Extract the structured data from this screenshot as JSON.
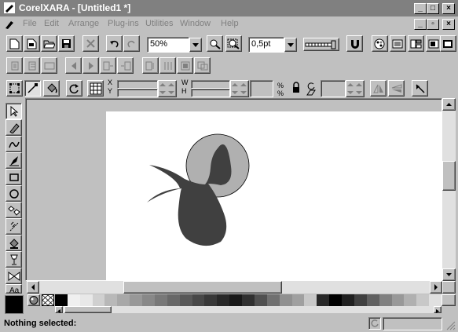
{
  "window": {
    "app_name": "CorelXARA",
    "document": "[Untitled1 *]",
    "title": "CorelXARA - [Untitled1 *]"
  },
  "menu": {
    "items": [
      {
        "label": "File",
        "active": false
      },
      {
        "label": "Edit",
        "active": false
      },
      {
        "label": "Arrange",
        "active": false
      },
      {
        "label": "Plug-ins",
        "active": false
      },
      {
        "label": "Utilities",
        "active": false
      },
      {
        "label": "Window",
        "active": false
      },
      {
        "label": "Help",
        "active": false
      }
    ]
  },
  "toolbar": {
    "zoom_value": "50%",
    "line_width_value": "0,5pt"
  },
  "infobar": {
    "x_label": "X",
    "y_label": "Y",
    "w_label": "W",
    "h_label": "H",
    "x_value": "",
    "y_value": "",
    "w_value": "",
    "h_value": "",
    "scale_value": "",
    "angle_value": ""
  },
  "status": {
    "message": "Nothing selected:"
  },
  "colors": {
    "circle_fill": "#b0b0b0",
    "shape_fill": "#404040",
    "palette": [
      "#000000",
      "#f0f0f0",
      "#e8e8e8",
      "#d0d0d0",
      "#b8b8b8",
      "#a8a8a8",
      "#989898",
      "#888888",
      "#787878",
      "#686868",
      "#585858",
      "#484848",
      "#383838",
      "#282828",
      "#181818",
      "#303030",
      "#505050",
      "#707070",
      "#909090",
      "#a0a0a0",
      "#c8c8c8",
      "#282828",
      "#000000",
      "#202020",
      "#404040",
      "#606060",
      "#808080",
      "#989898",
      "#b0b0b0",
      "#c8c8c8",
      "#e0e0e0"
    ]
  }
}
